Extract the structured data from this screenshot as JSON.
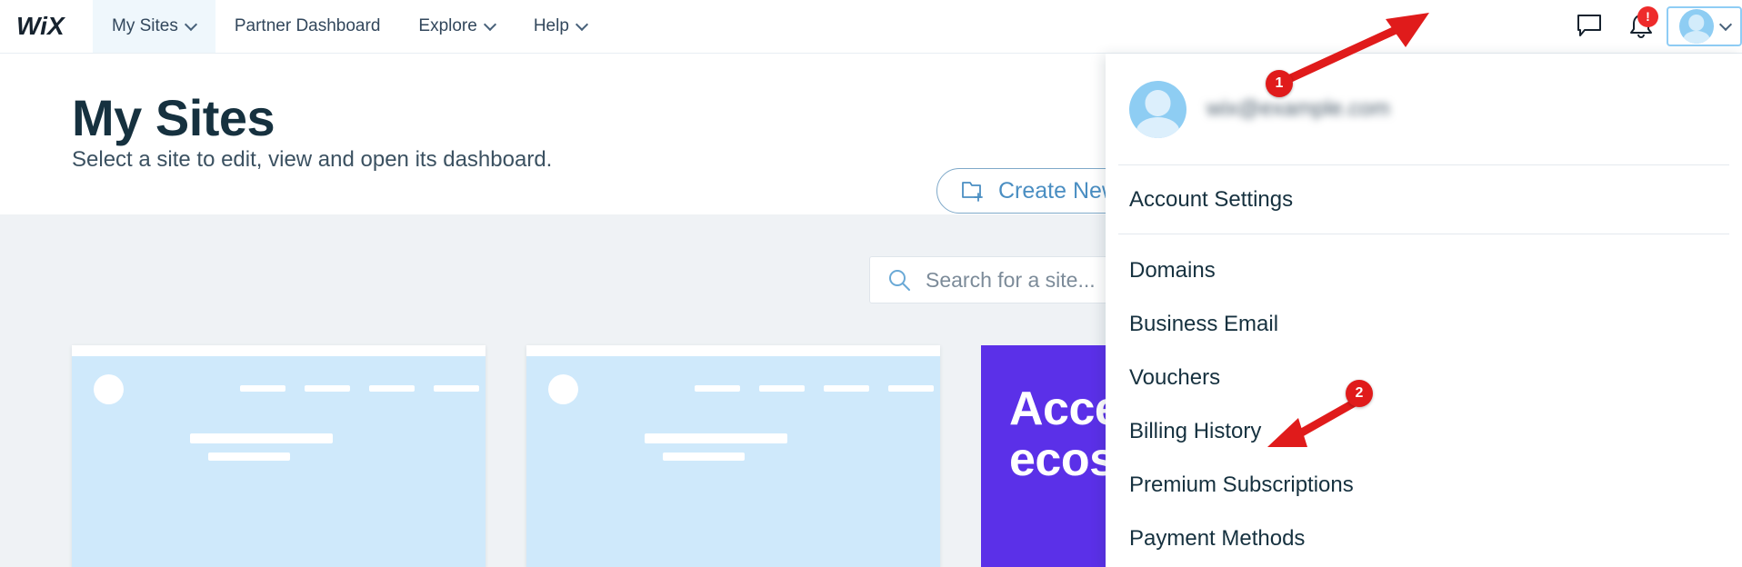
{
  "header": {
    "logo_text": "WiX",
    "nav": [
      {
        "label": "My Sites",
        "has_chevron": true,
        "active": true
      },
      {
        "label": "Partner Dashboard",
        "has_chevron": false,
        "active": false
      },
      {
        "label": "Explore",
        "has_chevron": true,
        "active": false
      },
      {
        "label": "Help",
        "has_chevron": true,
        "active": false
      }
    ],
    "icons": {
      "chat": "chat-bubble-icon",
      "notifications": "bell-icon",
      "notification_badge": "!",
      "avatar": "user-avatar-icon",
      "avatar_chevron": "chevron-down-icon"
    }
  },
  "page": {
    "title": "My Sites",
    "subtitle": "Select a site to edit, view and open its dashboard.",
    "create_folder_label": "Create New Fo",
    "create_folder_icon": "folder-plus-icon"
  },
  "search": {
    "placeholder": "Search for a site...",
    "icon": "search-icon"
  },
  "cards": {
    "site_skeletons": 2,
    "promo": {
      "line1": "Acces",
      "line2": "ecosy",
      "color": "#5b30e8"
    }
  },
  "dropdown": {
    "email": "wix@example.com",
    "account_settings": "Account Settings",
    "items": [
      {
        "label": "Domains"
      },
      {
        "label": "Business Email"
      },
      {
        "label": "Vouchers"
      },
      {
        "label": "Billing History"
      },
      {
        "label": "Premium Subscriptions"
      },
      {
        "label": "Payment Methods"
      }
    ]
  },
  "annotations": [
    {
      "number": "1",
      "target": "avatar-button"
    },
    {
      "number": "2",
      "target": "payment-methods-menu-item"
    }
  ],
  "colors": {
    "accent_blue": "#4a8ec2",
    "brand_dark": "#16313f",
    "promo_purple": "#5b30e8",
    "annotation_red": "#e01b1b",
    "alert_red": "#ee2b2b",
    "card_blue": "#cfe9fb",
    "page_bg": "#eff2f5"
  }
}
